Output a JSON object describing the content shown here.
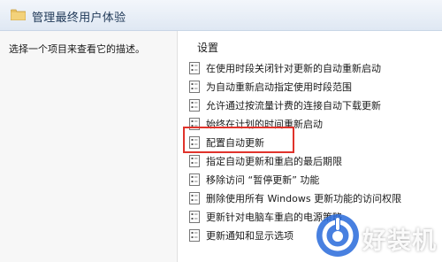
{
  "window": {
    "title": "管理最终用户体验"
  },
  "description_pane": {
    "text": "选择一个项目来查看它的描述。"
  },
  "list": {
    "column_header": "设置",
    "items": [
      {
        "label": "在使用时段关闭针对更新的自动重新启动"
      },
      {
        "label": "为自动重新启动指定使用时段范围"
      },
      {
        "label": "允许通过按流量计费的连接自动下载更新"
      },
      {
        "label": "始终在计划的时间重新启动"
      },
      {
        "label": "配置自动更新",
        "highlighted": true
      },
      {
        "label": "指定自动更新和重启的最后期限"
      },
      {
        "label": "移除访问 “暂停更新” 功能"
      },
      {
        "label": "删除使用所有 Windows 更新功能的访问权限"
      },
      {
        "label": "更新针对电脑车重启的电源策略"
      },
      {
        "label": "更新通知和显示选项"
      }
    ]
  },
  "watermark": {
    "text": "好装机",
    "icon": "logo-icon"
  },
  "colors": {
    "highlight_border": "#e0332b",
    "watermark_blue": "#2f6edc",
    "titlebar": "#dfe8f3"
  }
}
